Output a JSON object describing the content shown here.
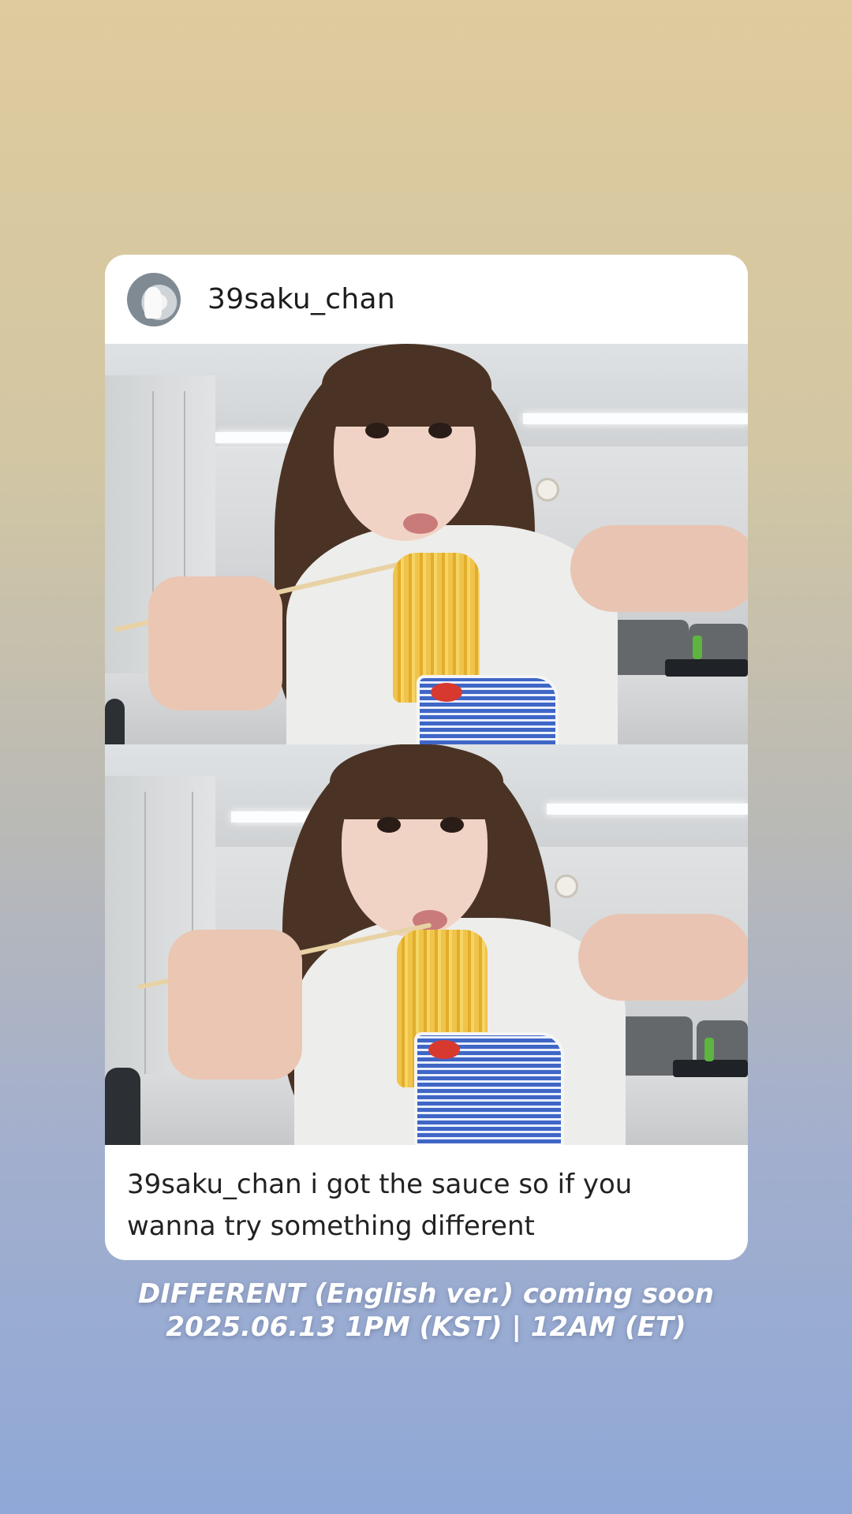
{
  "post": {
    "username": "39saku_chan",
    "avatar_icon": "profile-avatar",
    "caption": "39saku_chan i got the sauce so if you wanna try something different",
    "photos": [
      {
        "label": "selfie-photo-top"
      },
      {
        "label": "selfie-photo-bottom"
      }
    ]
  },
  "promo": {
    "line1": "DIFFERENT (English ver.) coming soon",
    "line2": "2025.06.13 1PM (KST) | 12AM (ET)"
  },
  "colors": {
    "bg_top": "#dfcb9d",
    "bg_bottom": "#8fa8d7",
    "card": "#ffffff",
    "text": "#222222",
    "promo_text": "#ffffff"
  }
}
